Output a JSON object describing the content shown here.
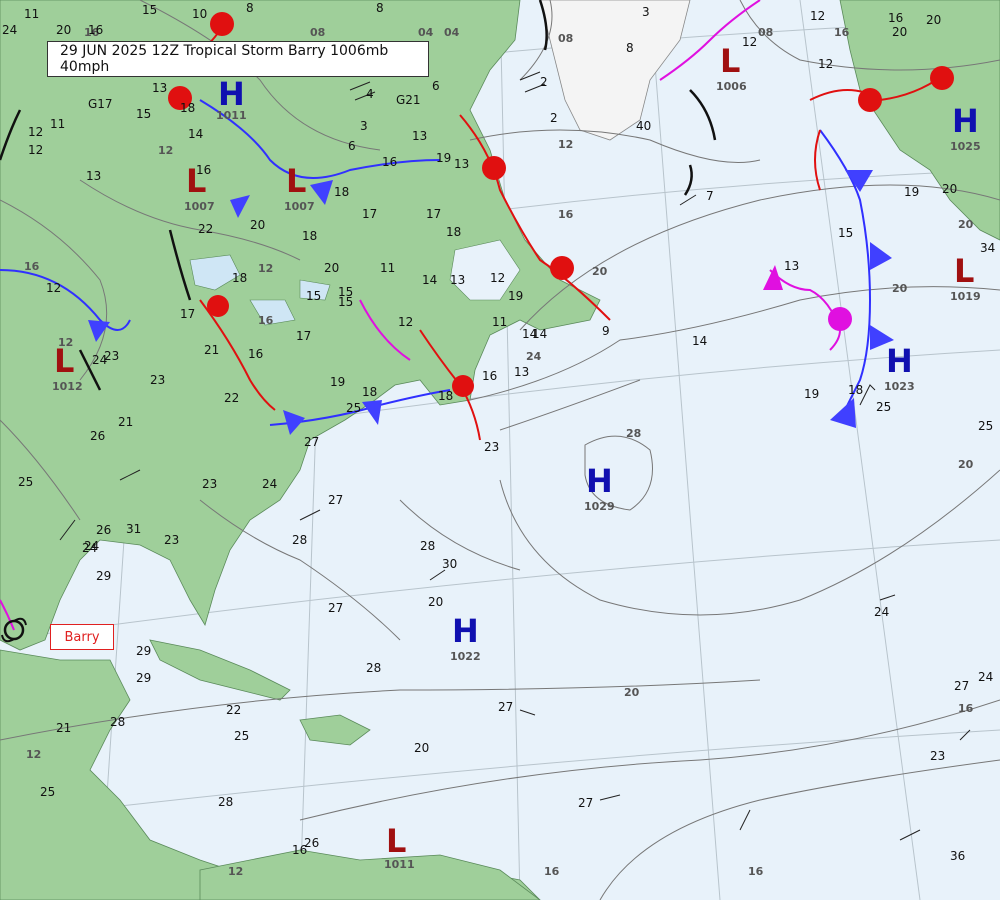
{
  "header": {
    "title": "29 JUN 2025 12Z Tropical Storm Barry 1006mb 40mph"
  },
  "storm_label": "Barry",
  "colors": {
    "land": "#9fcf9a",
    "land_dark": "#6fb07a",
    "ocean": "#e8f2fa",
    "high": "#1010b0",
    "low": "#a01010",
    "warm_front": "#e01010",
    "cold_front": "#3030ff",
    "occluded": "#e010e0",
    "isobar": "#777777"
  },
  "pressure_centers": [
    {
      "type": "H",
      "value": "1011"
    },
    {
      "type": "L",
      "value": "1007"
    },
    {
      "type": "L",
      "value": "1007"
    },
    {
      "type": "L",
      "value": "1006"
    },
    {
      "type": "H",
      "value": "1025"
    },
    {
      "type": "L",
      "value": "1012"
    },
    {
      "type": "H",
      "value": "1029"
    },
    {
      "type": "H",
      "value": "1023"
    },
    {
      "type": "L",
      "value": "1019"
    },
    {
      "type": "H",
      "value": "1022"
    },
    {
      "type": "L",
      "value": "1011"
    }
  ],
  "isobar_labels": [
    "08",
    "04",
    "04",
    "08",
    "08",
    "12",
    "16",
    "12",
    "16",
    "16",
    "12",
    "12",
    "16",
    "20",
    "16",
    "20",
    "24",
    "28",
    "20",
    "20",
    "20",
    "16",
    "16",
    "12",
    "12",
    "16"
  ],
  "observations": [
    "11",
    "24",
    "20",
    "16",
    "15",
    "10",
    "8",
    "8",
    "3",
    "8",
    "12",
    "16",
    "12",
    "20",
    "20",
    "12",
    "13",
    "G17",
    "15",
    "12",
    "11",
    "12",
    "18",
    "G21",
    "6",
    "4",
    "3",
    "6",
    "13",
    "2",
    "2",
    "40",
    "7",
    "14",
    "16",
    "19",
    "16",
    "18",
    "17",
    "13",
    "20",
    "18",
    "17",
    "11",
    "14",
    "13",
    "12",
    "22",
    "13",
    "19",
    "15",
    "20",
    "18",
    "15",
    "12",
    "14",
    "16",
    "18",
    "21",
    "16",
    "14",
    "11",
    "12",
    "23",
    "18",
    "17",
    "15",
    "19",
    "13",
    "18",
    "25",
    "24",
    "23",
    "22",
    "21",
    "26",
    "25",
    "27",
    "28",
    "29",
    "28",
    "26",
    "31",
    "23",
    "24",
    "27",
    "30",
    "27",
    "28",
    "23",
    "19",
    "13",
    "14",
    "9",
    "24",
    "23",
    "19",
    "25",
    "18",
    "15",
    "25",
    "20",
    "34",
    "27",
    "24",
    "27",
    "16",
    "20",
    "25",
    "36",
    "20",
    "24",
    "28",
    "27",
    "29",
    "17",
    "25",
    "21",
    "22",
    "29",
    "28",
    "26",
    "23",
    "24"
  ]
}
